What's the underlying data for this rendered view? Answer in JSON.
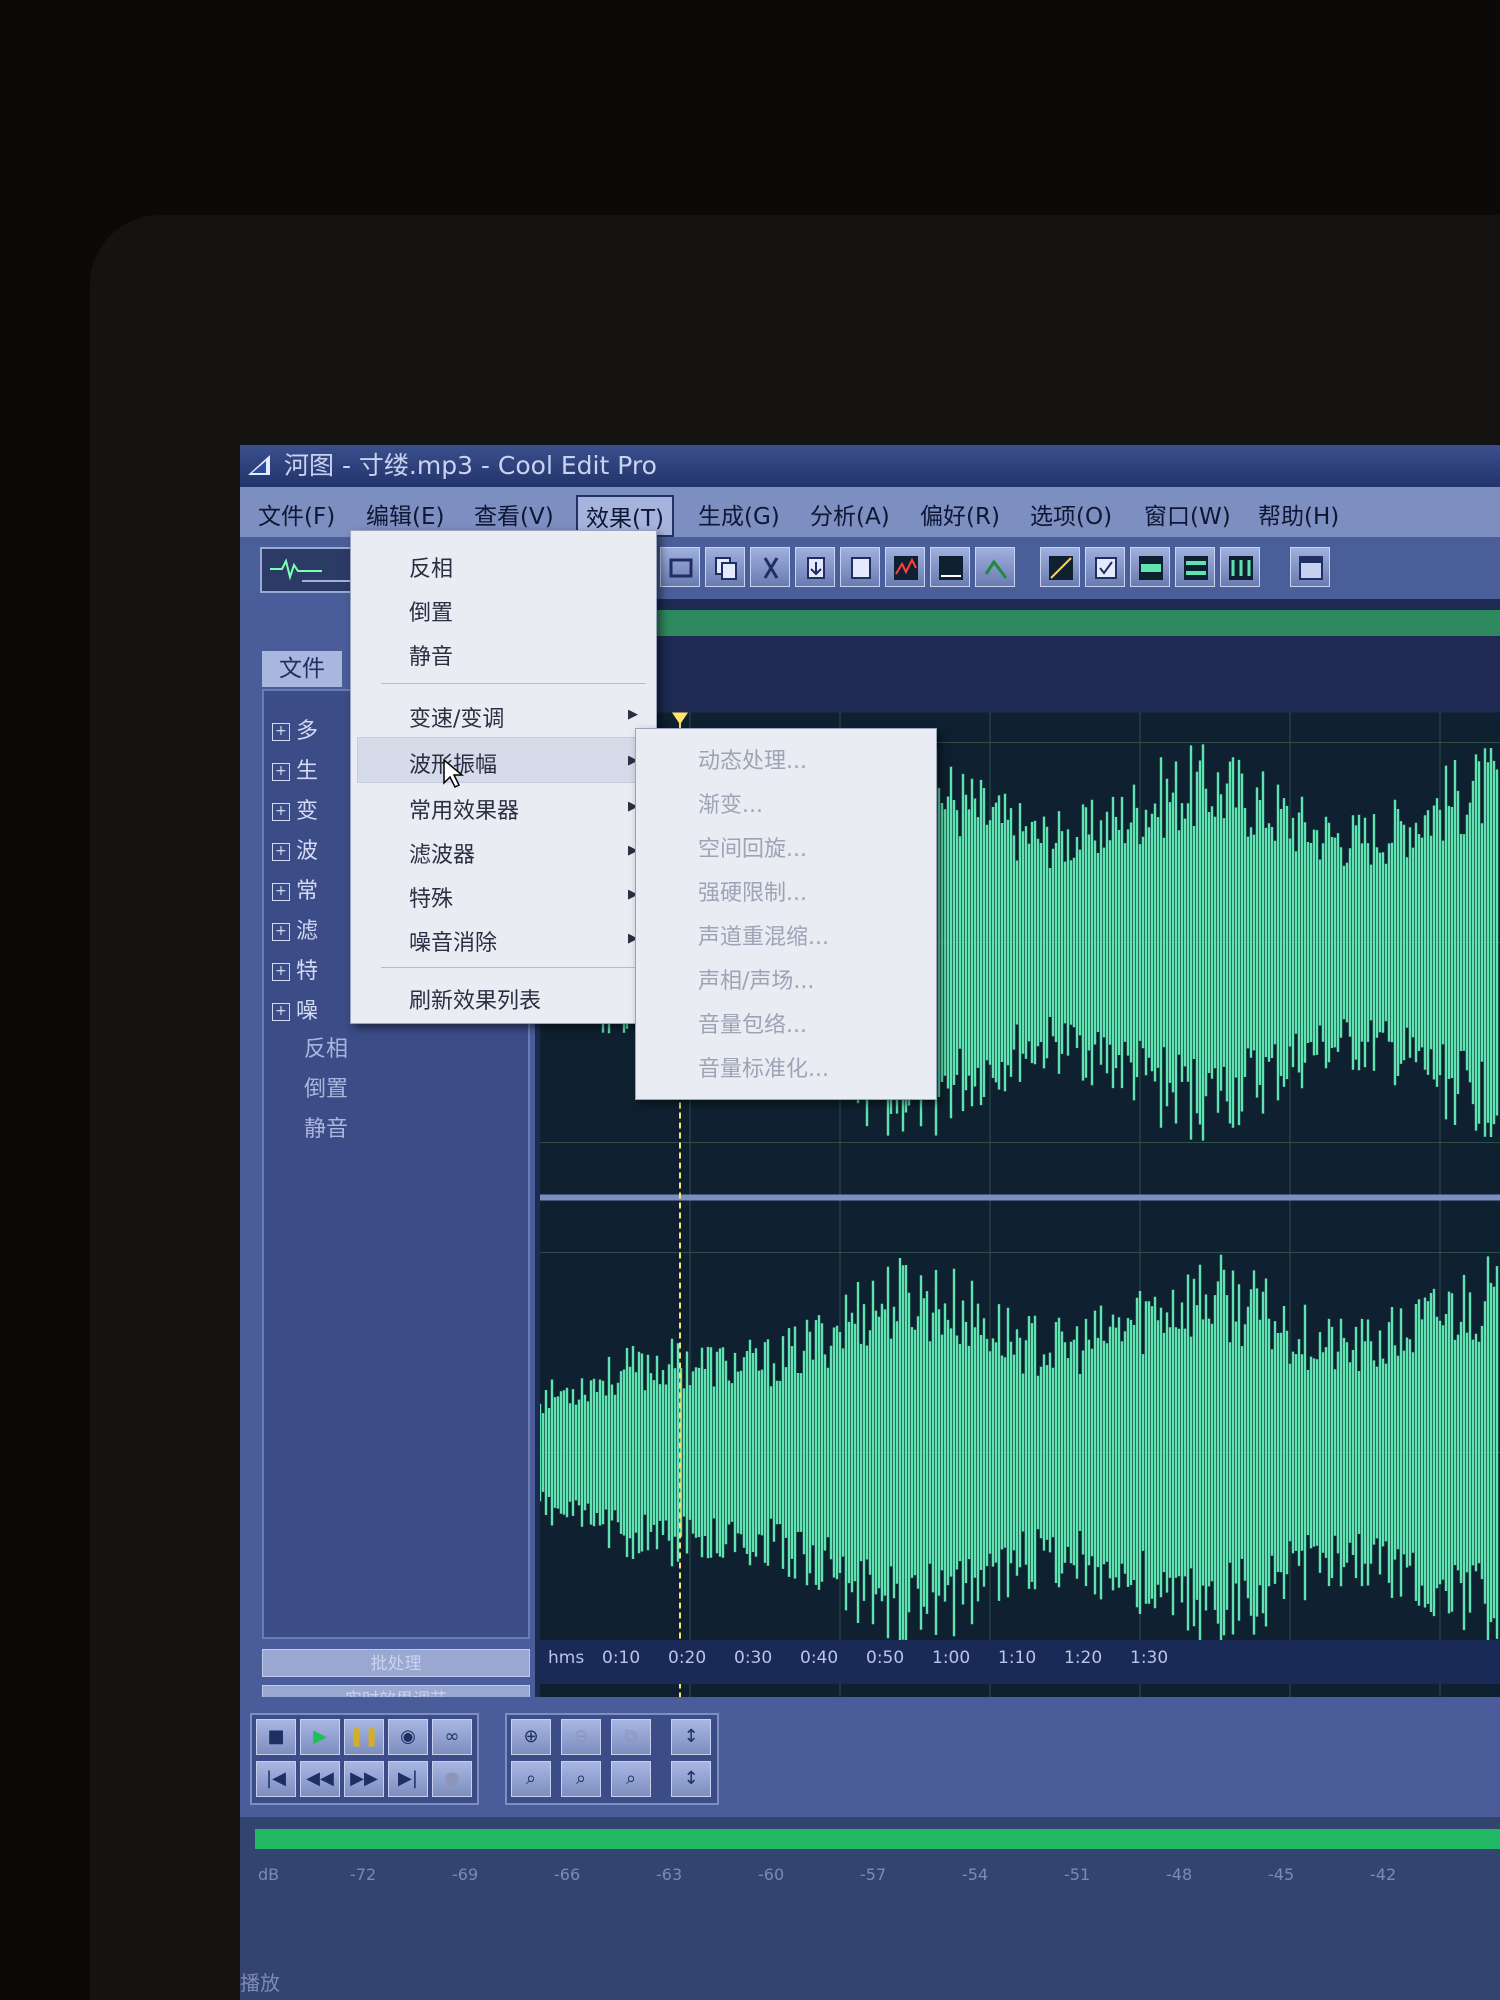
{
  "window": {
    "title": "河图 - 寸缕.mp3 - Cool Edit Pro"
  },
  "menubar": [
    {
      "label": "文件(F)"
    },
    {
      "label": "编辑(E)"
    },
    {
      "label": "查看(V)"
    },
    {
      "label": "效果(T)"
    },
    {
      "label": "生成(G)"
    },
    {
      "label": "分析(A)"
    },
    {
      "label": "偏好(R)"
    },
    {
      "label": "选项(O)"
    },
    {
      "label": "窗口(W)"
    },
    {
      "label": "帮助(H)"
    }
  ],
  "left_panel": {
    "tab": "文件",
    "tree_groups": [
      "多",
      "生",
      "变",
      "波",
      "常",
      "滤",
      "特",
      "噪"
    ],
    "tree_leaves": [
      "反相",
      "倒置",
      "静音"
    ],
    "buttons": [
      "批处理",
      "实时效果调节"
    ]
  },
  "effects_menu": {
    "items": [
      "反相",
      "倒置",
      "静音"
    ],
    "sub_items": [
      "变速/变调",
      "波形振幅",
      "常用效果器",
      "滤波器",
      "特殊",
      "噪音消除"
    ],
    "refresh": "刷新效果列表",
    "highlighted": "波形振幅"
  },
  "amplitude_submenu": {
    "items": [
      "动态处理...",
      "渐变...",
      "空间回旋...",
      "强硬限制...",
      "声道重混缩...",
      "声相/声场...",
      "音量包络...",
      "音量标准化..."
    ]
  },
  "ruler": {
    "unit": "hms",
    "ticks": [
      "0:10",
      "0:20",
      "0:30",
      "0:40",
      "0:50",
      "1:00",
      "1:10",
      "1:20",
      "1:30"
    ]
  },
  "level_meter": {
    "scale": [
      "dB",
      "-72",
      "-69",
      "-66",
      "-63",
      "-60",
      "-57",
      "-54",
      "-51",
      "-48",
      "-45",
      "-42"
    ]
  },
  "status": {
    "text": "播放"
  },
  "colors": {
    "waveform": "#5fe3b0",
    "background": "#0f2130",
    "accent": "#22b866"
  }
}
